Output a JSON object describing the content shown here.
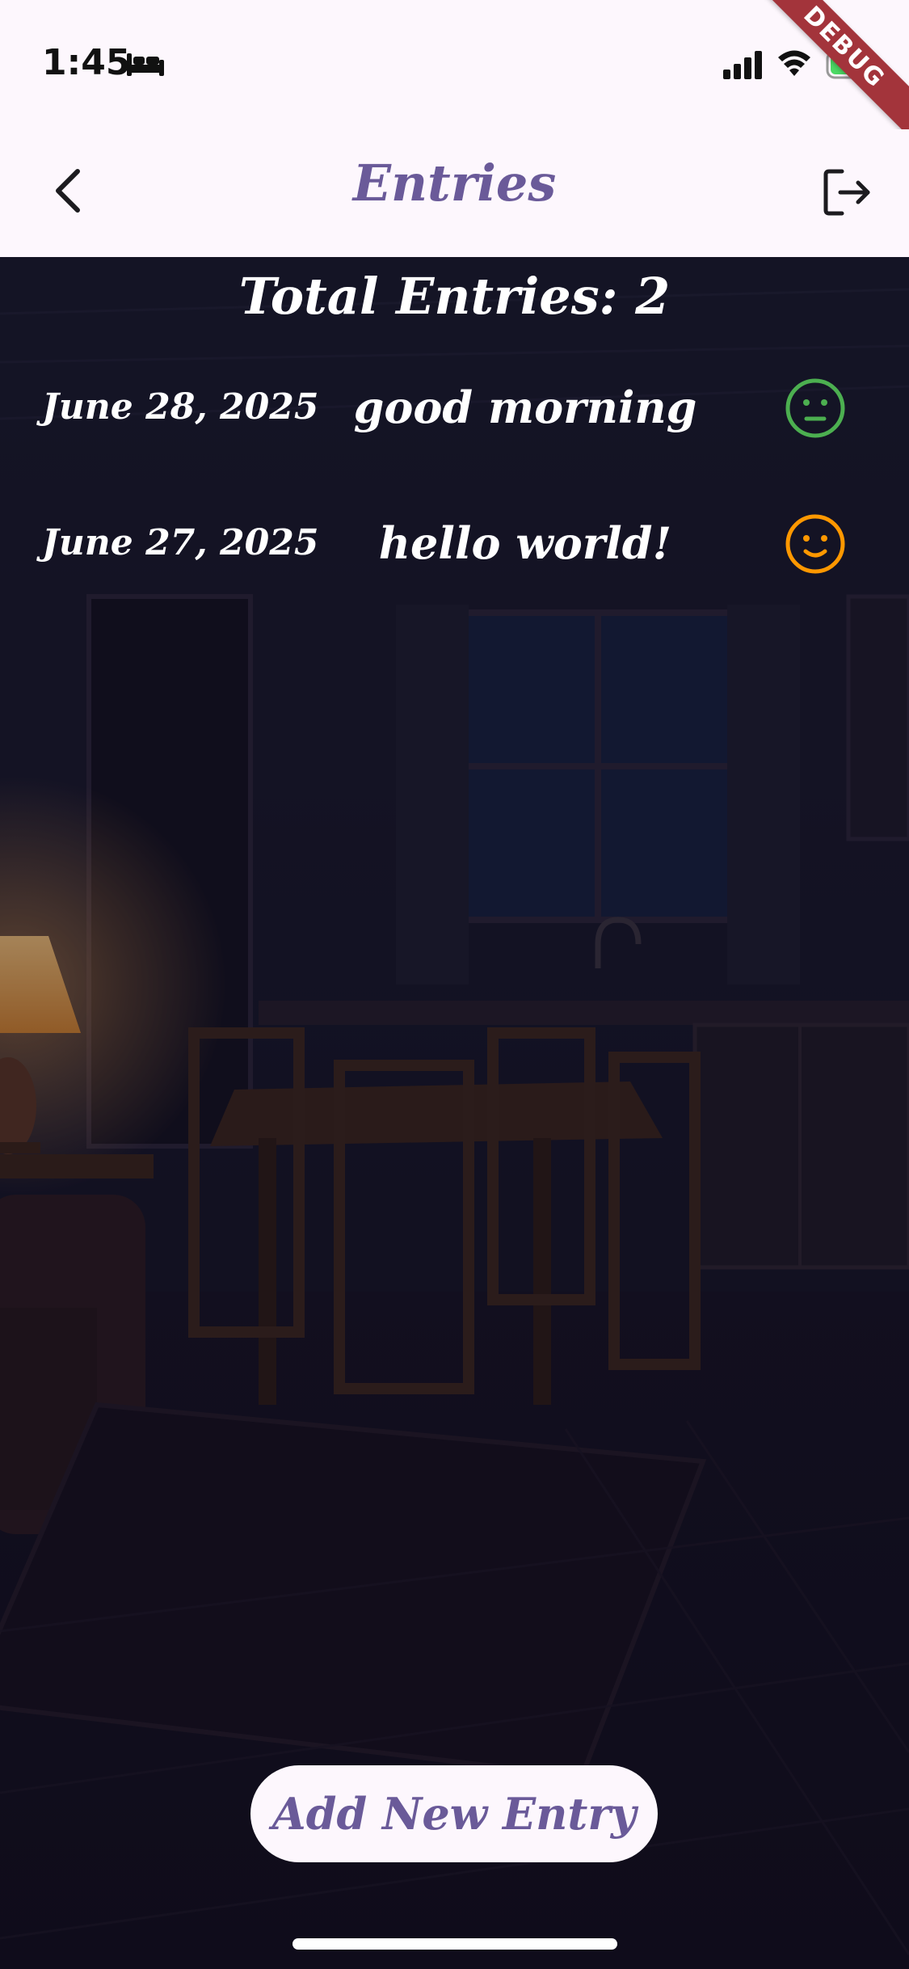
{
  "status_bar": {
    "time": "1:45",
    "debug_label": "DEBUG",
    "icons": [
      "bed-icon",
      "signal-icon",
      "wifi-icon",
      "battery-charging-icon"
    ]
  },
  "app_bar": {
    "title": "Entries",
    "back_icon": "chevron-left-icon",
    "logout_icon": "logout-icon"
  },
  "summary": {
    "total_label": "Total Entries: 2"
  },
  "entries": [
    {
      "date": "June 28, 2025",
      "title": "good morning",
      "mood": "neutral",
      "mood_color": "#4caf50"
    },
    {
      "date": "June 27, 2025",
      "title": "hello world!",
      "mood": "happy",
      "mood_color": "#ff9800"
    }
  ],
  "actions": {
    "add_entry_label": "Add New Entry"
  },
  "colors": {
    "accent": "#6a5a99",
    "bar_background": "#fdf7fd",
    "debug_banner": "#a3343b"
  }
}
